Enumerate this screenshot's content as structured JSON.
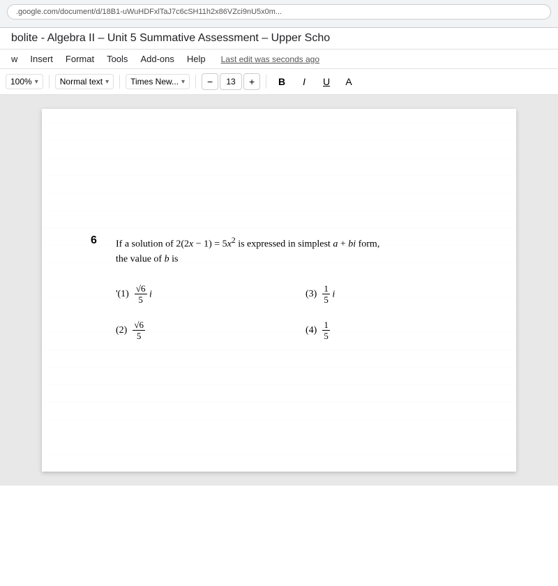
{
  "browser": {
    "address_text": ".google.com/document/d/18B1-uWuHDFxlTaJ7c6cSH11h2x86VZci9nU5x0m..."
  },
  "gdocs": {
    "title": "bolite - Algebra II – Unit 5 Summative Assessment – Upper Scho",
    "menu": {
      "items": [
        {
          "label": "w"
        },
        {
          "label": "Insert"
        },
        {
          "label": "Format"
        },
        {
          "label": "Tools"
        },
        {
          "label": "Add-ons"
        },
        {
          "label": "Help"
        }
      ],
      "last_edit": "Last edit was seconds ago"
    },
    "toolbar": {
      "zoom": "100%",
      "zoom_arrow": "▾",
      "style": "Normal text",
      "style_arrow": "▾",
      "font": "Times New...",
      "font_arrow": "▾",
      "minus": "−",
      "font_size": "13",
      "plus": "+",
      "bold": "B",
      "italic": "I",
      "underline": "U",
      "color": "A"
    }
  },
  "question": {
    "number": "6",
    "text_part1": "If a solution of 2(2",
    "text_x": "x",
    "text_part2": " − 1) = 5",
    "text_x2": "x",
    "text_exp": "2",
    "text_part3": " is expressed in simplest ",
    "text_a": "a",
    "text_plus": " + ",
    "text_bi": "bi",
    "text_part4": " form,",
    "text_line2": "the value of ",
    "text_b": "b",
    "text_line2_end": " is",
    "choices": [
      {
        "label": "(1)",
        "numerator": "√6",
        "denominator": "5",
        "suffix": "i"
      },
      {
        "label": "(3)",
        "numerator": "1",
        "denominator": "5",
        "suffix": "i"
      },
      {
        "label": "(2)",
        "numerator": "√6",
        "denominator": "5",
        "suffix": ""
      },
      {
        "label": "(4)",
        "numerator": "1",
        "denominator": "5",
        "suffix": ""
      }
    ]
  }
}
